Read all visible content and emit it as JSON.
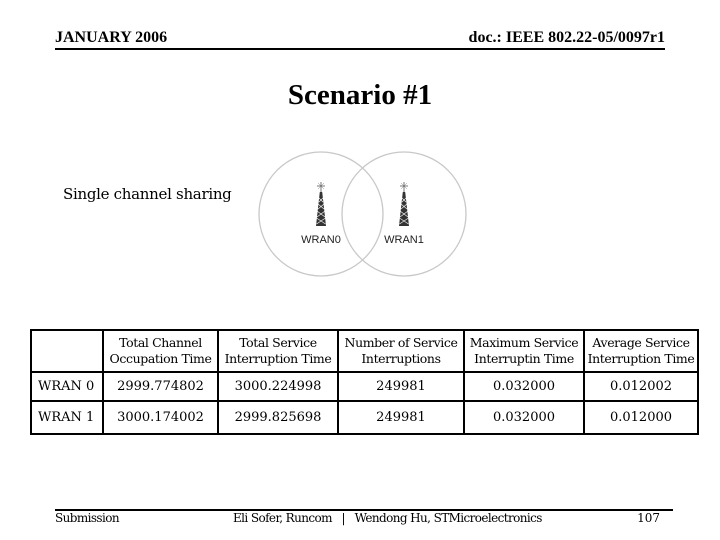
{
  "header": {
    "date": "JANUARY 2006",
    "doc_id": "doc.: IEEE 802.22-05/0097r1"
  },
  "title": "Scenario #1",
  "subtitle": "Single channel sharing",
  "diagram": {
    "stations": [
      {
        "label": "WRAN0",
        "icon": "radio-tower-icon"
      },
      {
        "label": "WRAN1",
        "icon": "radio-tower-icon"
      }
    ],
    "colors": {
      "circle": "#c8c8c8",
      "tower": "#222222"
    }
  },
  "table": {
    "columns": [
      "",
      "Total Channel Occupation Time",
      "Total Service Interruption Time",
      "Number of Service Interruptions",
      "Maximum Service Interruptin Time",
      "Average Service Interruption Time"
    ],
    "column_lines": [
      [
        "",
        ""
      ],
      [
        "Total Channel",
        "Occupation Time"
      ],
      [
        "Total Service",
        "Interruption Time"
      ],
      [
        "Number of Service",
        "Interruptions"
      ],
      [
        "Maximum Service",
        "Interruptin Time"
      ],
      [
        "Average Service",
        "Interruption Time"
      ]
    ],
    "rows": [
      {
        "label": "WRAN 0",
        "values": [
          "2999.774802",
          "3000.224998",
          "249981",
          "0.032000",
          "0.012002"
        ]
      },
      {
        "label": "WRAN 1",
        "values": [
          "3000.174002",
          "2999.825698",
          "249981",
          "0.032000",
          "0.012000"
        ]
      }
    ]
  },
  "footer": {
    "left": "Submission",
    "middle": "Eli Sofer, Runcom   |   Wendong Hu, STMicroelectronics",
    "page": "107"
  }
}
